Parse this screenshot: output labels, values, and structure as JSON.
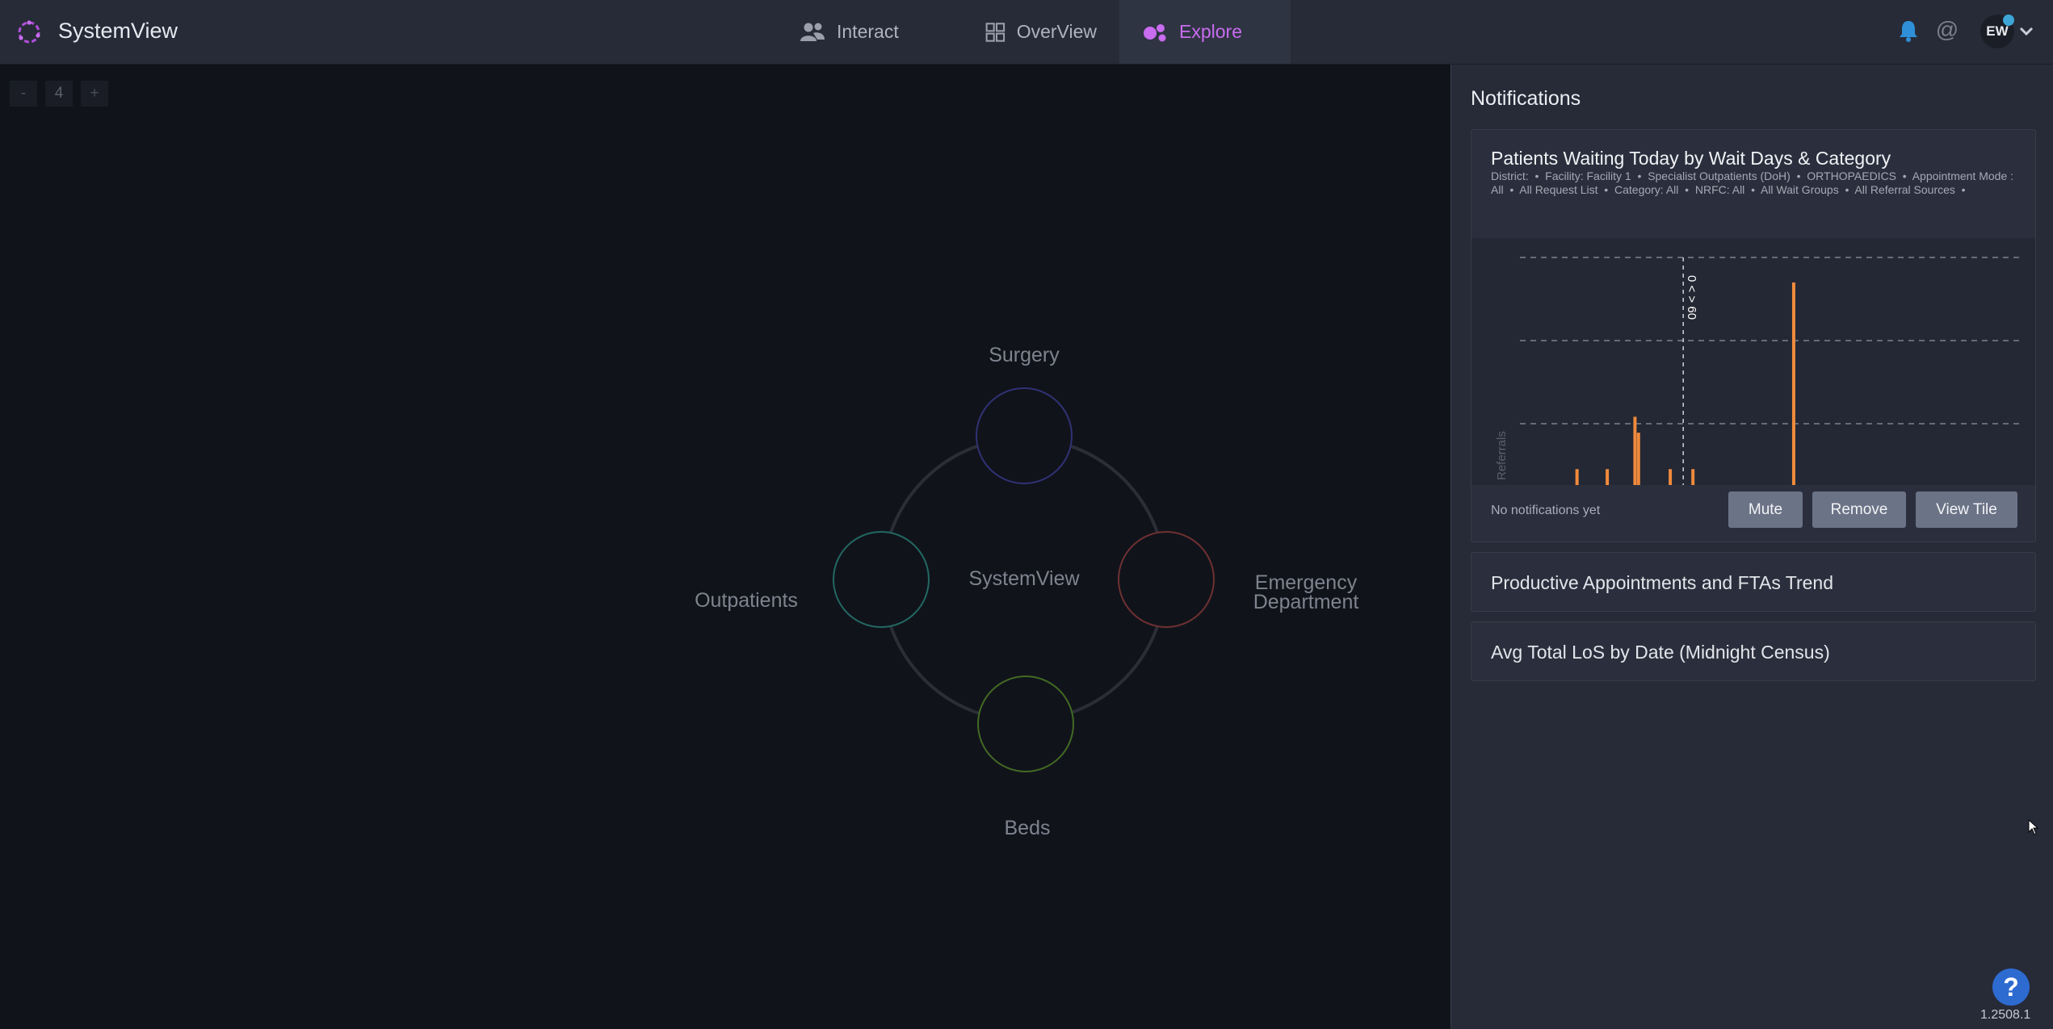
{
  "app": {
    "title": "SystemView"
  },
  "nav": {
    "tabs": [
      {
        "label": "Interact",
        "icon": "people-icon"
      },
      {
        "label": "OverView",
        "icon": "grid-icon"
      },
      {
        "label": "Explore",
        "icon": "explore-icon",
        "active": true
      }
    ]
  },
  "user": {
    "initials": "EW"
  },
  "zoom": {
    "minus": "-",
    "value": "4",
    "plus": "+"
  },
  "diagram": {
    "center": "SystemView",
    "nodes": [
      {
        "label": "Surgery",
        "color": "#3a3c8a"
      },
      {
        "label": "Outpatients",
        "color": "#2b7d74"
      },
      {
        "label": "Emergency Department",
        "line1": "Emergency",
        "line2": "Department",
        "color": "#8a3a3a"
      },
      {
        "label": "Beds",
        "color": "#4f7a2a"
      }
    ]
  },
  "notifications": {
    "title": "Notifications",
    "main_card": {
      "title": "Patients Waiting Today by Wait Days & Category",
      "filters": [
        "District:",
        "Facility: Facility 1",
        "Specialist Outpatients (DoH)",
        "ORTHOPAEDICS",
        "Appointment Mode : All",
        "All Request List",
        "Category: All",
        "NRFC: All",
        "All Wait Groups",
        "All Referral Sources"
      ],
      "footer_text": "No notifications yet",
      "buttons": {
        "mute": "Mute",
        "remove": "Remove",
        "view": "View Tile"
      }
    },
    "other_cards": [
      "Productive Appointments and FTAs Trend",
      "Avg Total LoS by Date (Midnight Census)"
    ]
  },
  "chart_data": {
    "type": "bar",
    "ylabel": "Referrals",
    "threshold_label": "0 < > 60",
    "grid": true,
    "bar_color": "#f08a3c",
    "bars": [
      {
        "x": 0.11,
        "v": 0.07
      },
      {
        "x": 0.17,
        "v": 0.07
      },
      {
        "x": 0.225,
        "v": 0.3
      },
      {
        "x": 0.232,
        "v": 0.23
      },
      {
        "x": 0.295,
        "v": 0.07
      },
      {
        "x": 0.34,
        "v": 0.07
      },
      {
        "x": 0.54,
        "v": 0.89
      }
    ],
    "threshold_x": 0.324
  },
  "help": {
    "label": "?"
  },
  "version": "1.2508.1"
}
